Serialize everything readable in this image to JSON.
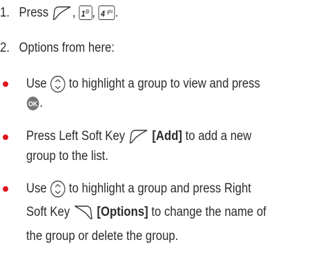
{
  "steps": [
    {
      "num": "1.",
      "text": "Press",
      "comma1": ",",
      "comma2": ",",
      "end": "."
    },
    {
      "num": "2.",
      "text": "Options from here:"
    }
  ],
  "keys": {
    "key1_main": "1",
    "key1_sub": "@",
    "key4_main": "4",
    "key4_sub": "ghi"
  },
  "bullets": [
    {
      "a": "Use",
      "b": "to highlight a group to view and press",
      "c": "."
    },
    {
      "a": "Press Left Soft Key",
      "b": "[Add]",
      "c": "to add a new",
      "d": "group to the list."
    },
    {
      "a": "Use",
      "b": "to highlight a group and press Right",
      "c": "Soft Key",
      "d": "[Options]",
      "e": "to change the name of",
      "f": "the group or delete the group."
    }
  ],
  "ok_label": "OK",
  "colors": {
    "bullet": "#e0141c",
    "text": "#2b2b2b"
  }
}
